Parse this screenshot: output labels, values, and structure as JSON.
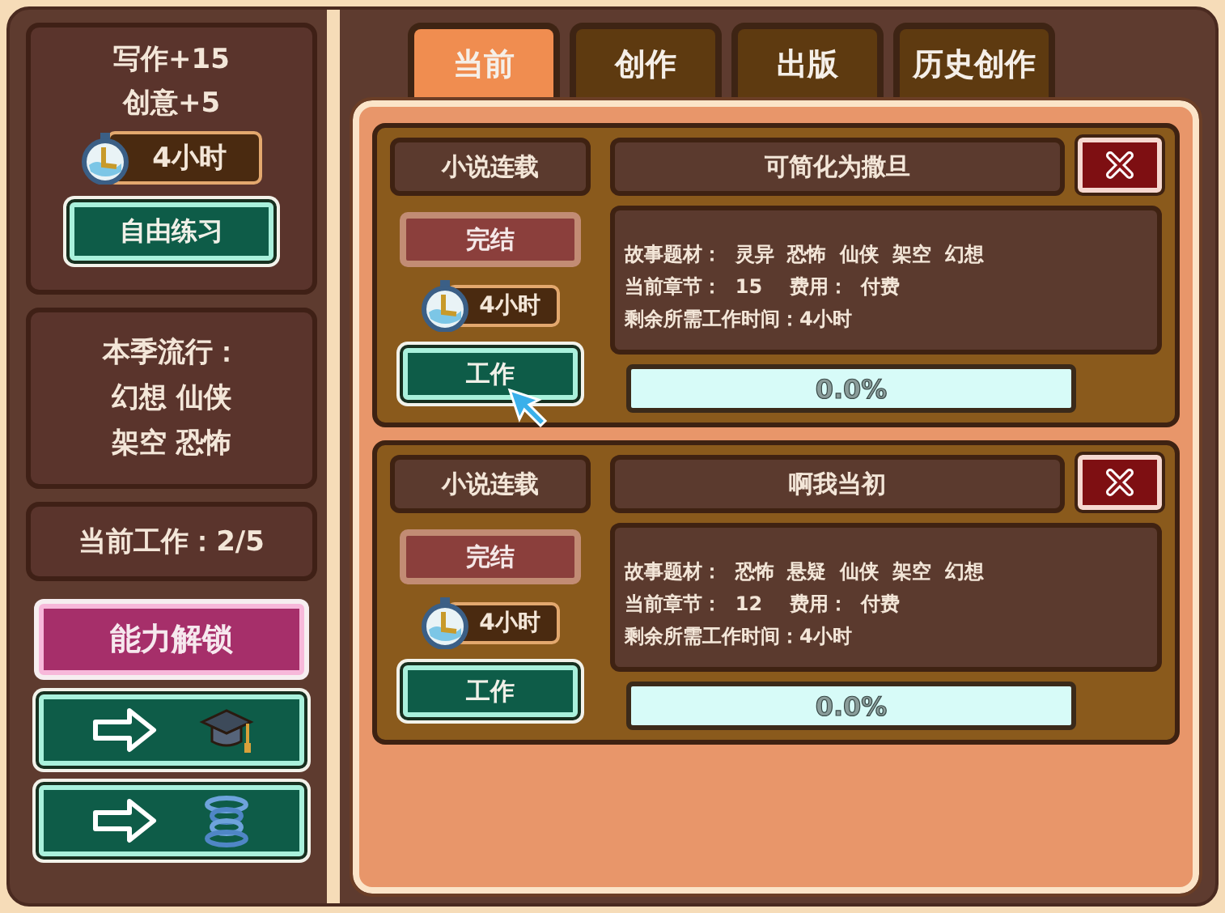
{
  "sidebar": {
    "stats": [
      "写作+15",
      "创意+5"
    ],
    "timer": "4小时",
    "practice_button": "自由练习",
    "trend_title": "本季流行：",
    "trend_lines": [
      "幻想 仙侠",
      "架空 恐怖"
    ],
    "current_work": "当前工作：2/5",
    "unlock_button": "能力解锁",
    "shortcut_buttons": [
      {
        "kind": "graduation"
      },
      {
        "kind": "spring"
      }
    ]
  },
  "tabs": [
    {
      "label": "当前",
      "selected": true
    },
    {
      "label": "创作",
      "selected": false
    },
    {
      "label": "出版",
      "selected": false
    },
    {
      "label": "历史创作",
      "selected": false
    }
  ],
  "works": [
    {
      "type": "小说连载",
      "title": "可简化为撒旦",
      "finish_button": "完结",
      "timer": "4小时",
      "work_button": "工作",
      "hovered": true,
      "genres": "故事题材：  灵异  恐怖  仙侠  架空  幻想",
      "chapter": "当前章节：  15    费用：  付费",
      "remaining": "剩余所需工作时间：4小时",
      "progress": {
        "level": 0,
        "reading": "0.0%"
      }
    },
    {
      "type": "小说连载",
      "title": "啊我当初",
      "finish_button": "完结",
      "timer": "4小时",
      "work_button": "工作",
      "hovered": false,
      "genres": "故事题材：  恐怖  悬疑  仙侠  架空  幻想",
      "chapter": "当前章节：  12    费用：  付费",
      "remaining": "剩余所需工作时间：4小时",
      "progress": {
        "level": 0,
        "reading": "0.0%"
      }
    }
  ]
}
